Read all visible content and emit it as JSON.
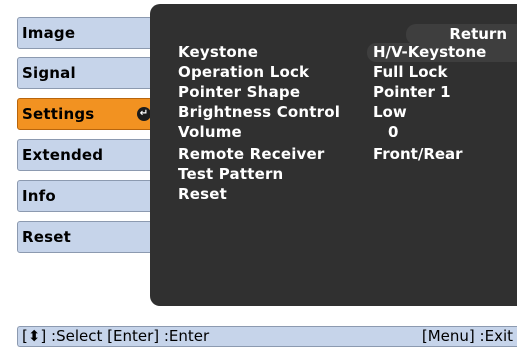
{
  "tabs": [
    {
      "label": "Image",
      "active": false
    },
    {
      "label": "Signal",
      "active": false
    },
    {
      "label": "Settings",
      "active": true
    },
    {
      "label": "Extended",
      "active": false
    },
    {
      "label": "Info",
      "active": false
    },
    {
      "label": "Reset",
      "active": false
    }
  ],
  "return_label": "Return",
  "menu_items": [
    {
      "label": "Keystone",
      "value": "H/V-Keystone"
    },
    {
      "label": "Operation Lock",
      "value": "Full Lock"
    },
    {
      "label": "Pointer Shape",
      "value": "Pointer 1"
    },
    {
      "label": "Brightness Control",
      "value": "Low"
    },
    {
      "label": "Volume",
      "value": "0"
    },
    {
      "label": "Remote Receiver",
      "value": "Front/Rear"
    },
    {
      "label": "Test Pattern",
      "value": ""
    },
    {
      "label": "Reset",
      "value": ""
    }
  ],
  "help": {
    "left": "[⬍] :Select  [Enter] :Enter",
    "right": "[Menu] :Exit"
  },
  "colors": {
    "tab_bg": "#c6d4ea",
    "tab_active_bg": "#f29221",
    "panel_bg": "#303030",
    "text_light": "#ffffff"
  },
  "icons": {
    "enter": "enter-return-icon"
  }
}
